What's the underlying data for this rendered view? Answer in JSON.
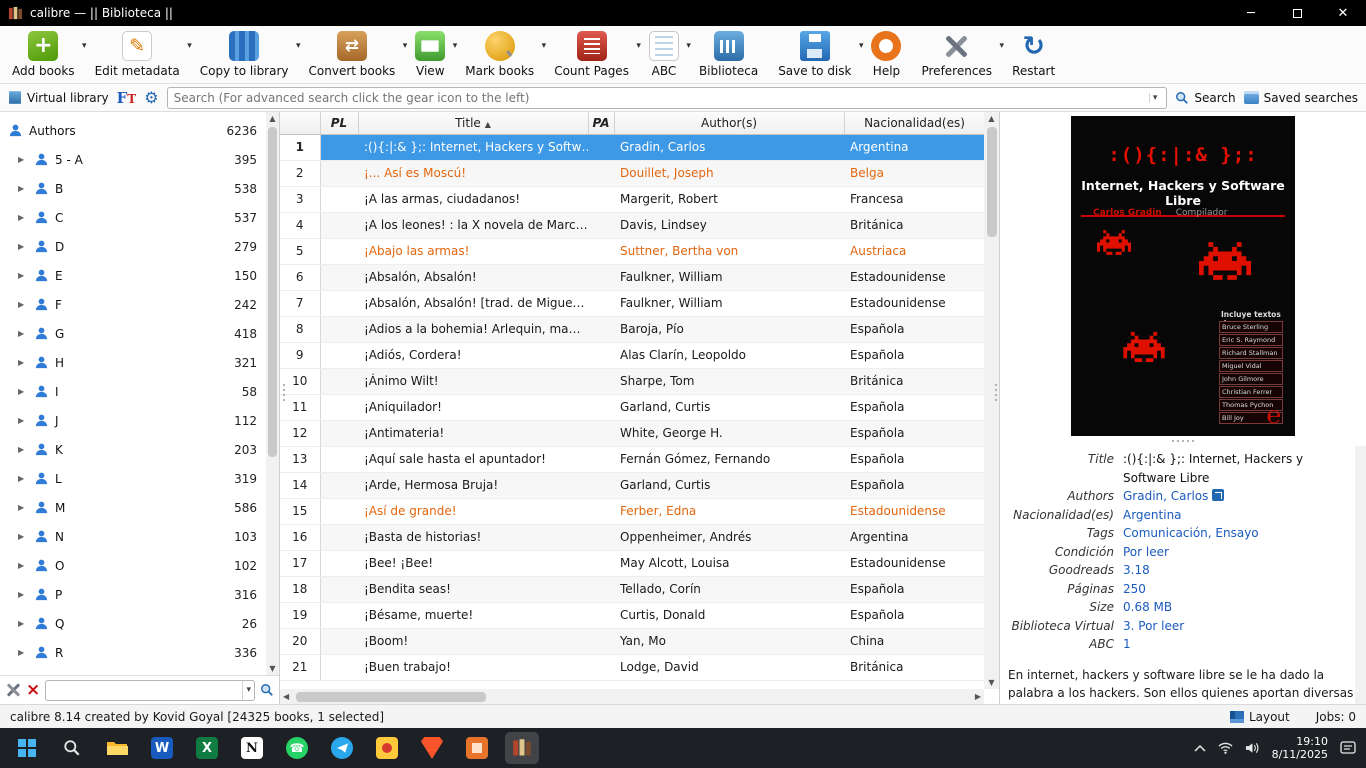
{
  "titlebar": {
    "title": "calibre — || Biblioteca ||"
  },
  "toolbar": {
    "items": [
      {
        "icon": "add-books",
        "label": "Add books",
        "dropdown": true
      },
      {
        "icon": "edit-metadata",
        "label": "Edit metadata",
        "dropdown": true
      },
      {
        "icon": "copy-to-library",
        "label": "Copy to library",
        "dropdown": true
      },
      {
        "icon": "convert-books",
        "label": "Convert books",
        "dropdown": true
      },
      {
        "icon": "view",
        "label": "View",
        "dropdown": true
      },
      {
        "icon": "mark-books",
        "label": "Mark books",
        "dropdown": true
      },
      {
        "icon": "count-pages",
        "label": "Count Pages",
        "dropdown": true
      },
      {
        "icon": "abc",
        "label": "ABC",
        "dropdown": true
      },
      {
        "icon": "biblioteca",
        "label": "Biblioteca",
        "dropdown": false
      },
      {
        "icon": "save-to-disk",
        "label": "Save to disk",
        "dropdown": true
      },
      {
        "icon": "help",
        "label": "Help",
        "dropdown": false
      },
      {
        "icon": "preferences",
        "label": "Preferences",
        "dropdown": true
      },
      {
        "icon": "restart",
        "label": "Restart",
        "dropdown": false
      }
    ]
  },
  "searchbar": {
    "virtual_library": "Virtual library",
    "placeholder": "Search (For advanced search click the gear icon to the left)",
    "search_label": "Search",
    "saved_searches_label": "Saved searches"
  },
  "sidebar": {
    "root": {
      "label": "Authors",
      "count": "6236"
    },
    "items": [
      {
        "label": "5 - A",
        "count": "395"
      },
      {
        "label": "B",
        "count": "538"
      },
      {
        "label": "C",
        "count": "537"
      },
      {
        "label": "D",
        "count": "279"
      },
      {
        "label": "E",
        "count": "150"
      },
      {
        "label": "F",
        "count": "242"
      },
      {
        "label": "G",
        "count": "418"
      },
      {
        "label": "H",
        "count": "321"
      },
      {
        "label": "I",
        "count": "58"
      },
      {
        "label": "J",
        "count": "112"
      },
      {
        "label": "K",
        "count": "203"
      },
      {
        "label": "L",
        "count": "319"
      },
      {
        "label": "M",
        "count": "586"
      },
      {
        "label": "N",
        "count": "103"
      },
      {
        "label": "O",
        "count": "102"
      },
      {
        "label": "P",
        "count": "316"
      },
      {
        "label": "Q",
        "count": "26"
      },
      {
        "label": "R",
        "count": "336"
      }
    ]
  },
  "table": {
    "columns": {
      "pl": "PL",
      "title": "Title",
      "pa": "PA",
      "authors": "Author(s)",
      "nationality": "Nacionalidad(es)"
    },
    "sort_indicator": "▲",
    "rows": [
      {
        "num": "1",
        "title": ":(){:|:& };: Internet, Hackers y Softw…",
        "authors": "Gradin, Carlos",
        "nationality": "Argentina",
        "state": "selected"
      },
      {
        "num": "2",
        "title": "¡... Así es Moscú!",
        "authors": "Douillet, Joseph",
        "nationality": "Belga",
        "state": "marked"
      },
      {
        "num": "3",
        "title": "¡A las armas, ciudadanos!",
        "authors": "Margerit, Robert",
        "nationality": "Francesa",
        "state": "normal"
      },
      {
        "num": "4",
        "title": "¡A los leones! : la X novela de Marc…",
        "authors": "Davis, Lindsey",
        "nationality": "Británica",
        "state": "normal"
      },
      {
        "num": "5",
        "title": "¡Abajo las armas!",
        "authors": "Suttner, Bertha von",
        "nationality": "Austriaca",
        "state": "marked"
      },
      {
        "num": "6",
        "title": "¡Absalón, Absalón!",
        "authors": "Faulkner, William",
        "nationality": "Estadounidense",
        "state": "normal"
      },
      {
        "num": "7",
        "title": "¡Absalón, Absalón! [trad. de Migue…",
        "authors": "Faulkner, William",
        "nationality": "Estadounidense",
        "state": "normal"
      },
      {
        "num": "8",
        "title": "¡Adios a la bohemia! Arlequin, ma…",
        "authors": "Baroja, Pío",
        "nationality": "Española",
        "state": "normal"
      },
      {
        "num": "9",
        "title": "¡Adiós, Cordera!",
        "authors": "Alas Clarín, Leopoldo",
        "nationality": "Española",
        "state": "normal"
      },
      {
        "num": "10",
        "title": "¡Ánimo Wilt!",
        "authors": "Sharpe, Tom",
        "nationality": "Británica",
        "state": "normal"
      },
      {
        "num": "11",
        "title": "¡Aniquilador!",
        "authors": "Garland, Curtis",
        "nationality": "Española",
        "state": "normal"
      },
      {
        "num": "12",
        "title": "¡Antimateria!",
        "authors": "White, George H.",
        "nationality": "Española",
        "state": "normal"
      },
      {
        "num": "13",
        "title": "¡Aquí sale hasta el apuntador!",
        "authors": "Fernán Gómez, Fernando",
        "nationality": "Española",
        "state": "normal"
      },
      {
        "num": "14",
        "title": "¡Arde, Hermosa Bruja!",
        "authors": "Garland, Curtis",
        "nationality": "Española",
        "state": "normal"
      },
      {
        "num": "15",
        "title": "¡Así de grande!",
        "authors": "Ferber, Edna",
        "nationality": "Estadounidense",
        "state": "marked"
      },
      {
        "num": "16",
        "title": "¡Basta de historias!",
        "authors": "Oppenheimer, Andrés",
        "nationality": "Argentina",
        "state": "normal"
      },
      {
        "num": "17",
        "title": "¡Bee! ¡Bee!",
        "authors": "May Alcott, Louisa",
        "nationality": "Estadounidense",
        "state": "normal"
      },
      {
        "num": "18",
        "title": "¡Bendita seas!",
        "authors": "Tellado, Corín",
        "nationality": "Española",
        "state": "normal"
      },
      {
        "num": "19",
        "title": "¡Bésame, muerte!",
        "authors": "Curtis, Donald",
        "nationality": "Española",
        "state": "normal"
      },
      {
        "num": "20",
        "title": "¡Boom!",
        "authors": "Yan, Mo",
        "nationality": "China",
        "state": "normal"
      },
      {
        "num": "21",
        "title": "¡Buen trabajo!",
        "authors": "Lodge, David",
        "nationality": "Británica",
        "state": "normal"
      }
    ]
  },
  "book_panel": {
    "cover": {
      "ascii_title": ":(){:|:& };:",
      "title": "Internet, Hackers y Software Libre",
      "author": "Carlos Gradin",
      "role": "Compilador",
      "includes_heading": "Incluye textos de:",
      "includes": [
        "Bruce Sterling",
        "Eric S. Raymond",
        "Richard Stallman",
        "Miguel Vidal",
        "John Gilmore",
        "Christian Ferrer",
        "Thomas Pychon",
        "Bill Joy"
      ]
    },
    "details": [
      {
        "label": "Title",
        "value": ":(){:|:& };: Internet, Hackers y Software Libre",
        "type": "text"
      },
      {
        "label": "Authors",
        "value": "Gradin, Carlos",
        "type": "link-external"
      },
      {
        "label": "Nacionalidad(es)",
        "value": "Argentina",
        "type": "link"
      },
      {
        "label": "Tags",
        "value": "Comunicación, Ensayo",
        "type": "link"
      },
      {
        "label": "Condición",
        "value": "Por leer",
        "type": "link"
      },
      {
        "label": "Goodreads",
        "value": "3.18",
        "type": "link"
      },
      {
        "label": "Páginas",
        "value": "250",
        "type": "link"
      },
      {
        "label": "Size",
        "value": "0.68 MB",
        "type": "link"
      },
      {
        "label": "Biblioteca Virtual",
        "value": "3. Por leer",
        "type": "link"
      },
      {
        "label": "ABC",
        "value": "1",
        "type": "link"
      }
    ],
    "description": "En internet, hackers y software libre se le ha dado la palabra a los hackers. Son ellos quienes aportan diversas"
  },
  "statusbar": {
    "left": "calibre 8.14 created by Kovid Goyal  [24325 books, 1 selected]",
    "layout_label": "Layout",
    "jobs_label": "Jobs: 0"
  },
  "taskbar": {
    "time": "19:10",
    "date": "8/11/2025"
  }
}
